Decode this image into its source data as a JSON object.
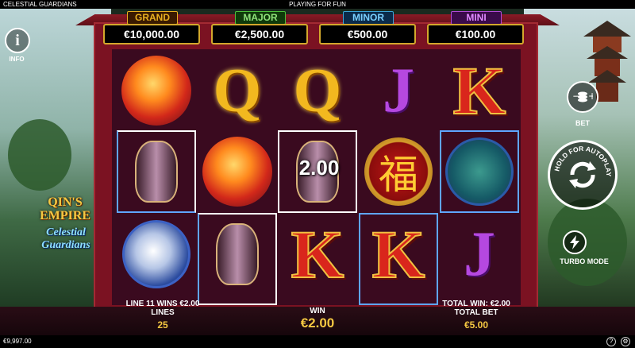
{
  "topbar": {
    "game_title": "CELESTIAL GUARDIANS",
    "mode": "PLAYING FOR FUN"
  },
  "jackpots": [
    {
      "label": "GRAND",
      "value": "€10,000.00",
      "color": "#e8b020"
    },
    {
      "label": "MAJOR",
      "value": "€2,500.00",
      "color": "#4cbf3a"
    },
    {
      "label": "MINOR",
      "value": "€500.00",
      "color": "#3aa4d8"
    },
    {
      "label": "MINI",
      "value": "€100.00",
      "color": "#b34ad8"
    }
  ],
  "reels": [
    [
      "phoenix",
      "vase",
      "wolf"
    ],
    [
      "Q",
      "phoenix",
      "vase"
    ],
    [
      "Q",
      "vase",
      "K"
    ],
    [
      "J",
      "fortune-coin",
      "K"
    ],
    [
      "K",
      "turtle",
      "J"
    ]
  ],
  "win_amount_on_reel": "2.00",
  "side": {
    "info_label": "INFO",
    "bet_label": "BET",
    "autoplay_label": "HOLD FOR AUTOPLAY",
    "turbo_label": "TURBO MODE",
    "logo_line1": "QIN'S EMPIRE",
    "logo_line2": "Celestial Guardians"
  },
  "bottom": {
    "line_win_text": "LINE 11 WINS €2.00",
    "lines_label": "LINES",
    "lines_value": "25",
    "win_label": "WIN",
    "win_value": "€2.00",
    "total_win_text": "TOTAL WIN: €2.00",
    "total_bet_label": "TOTAL BET",
    "total_bet_value": "€5.00"
  },
  "footer": {
    "balance": "€9,997.00",
    "help_icon": "?",
    "settings_icon": "⚙"
  }
}
